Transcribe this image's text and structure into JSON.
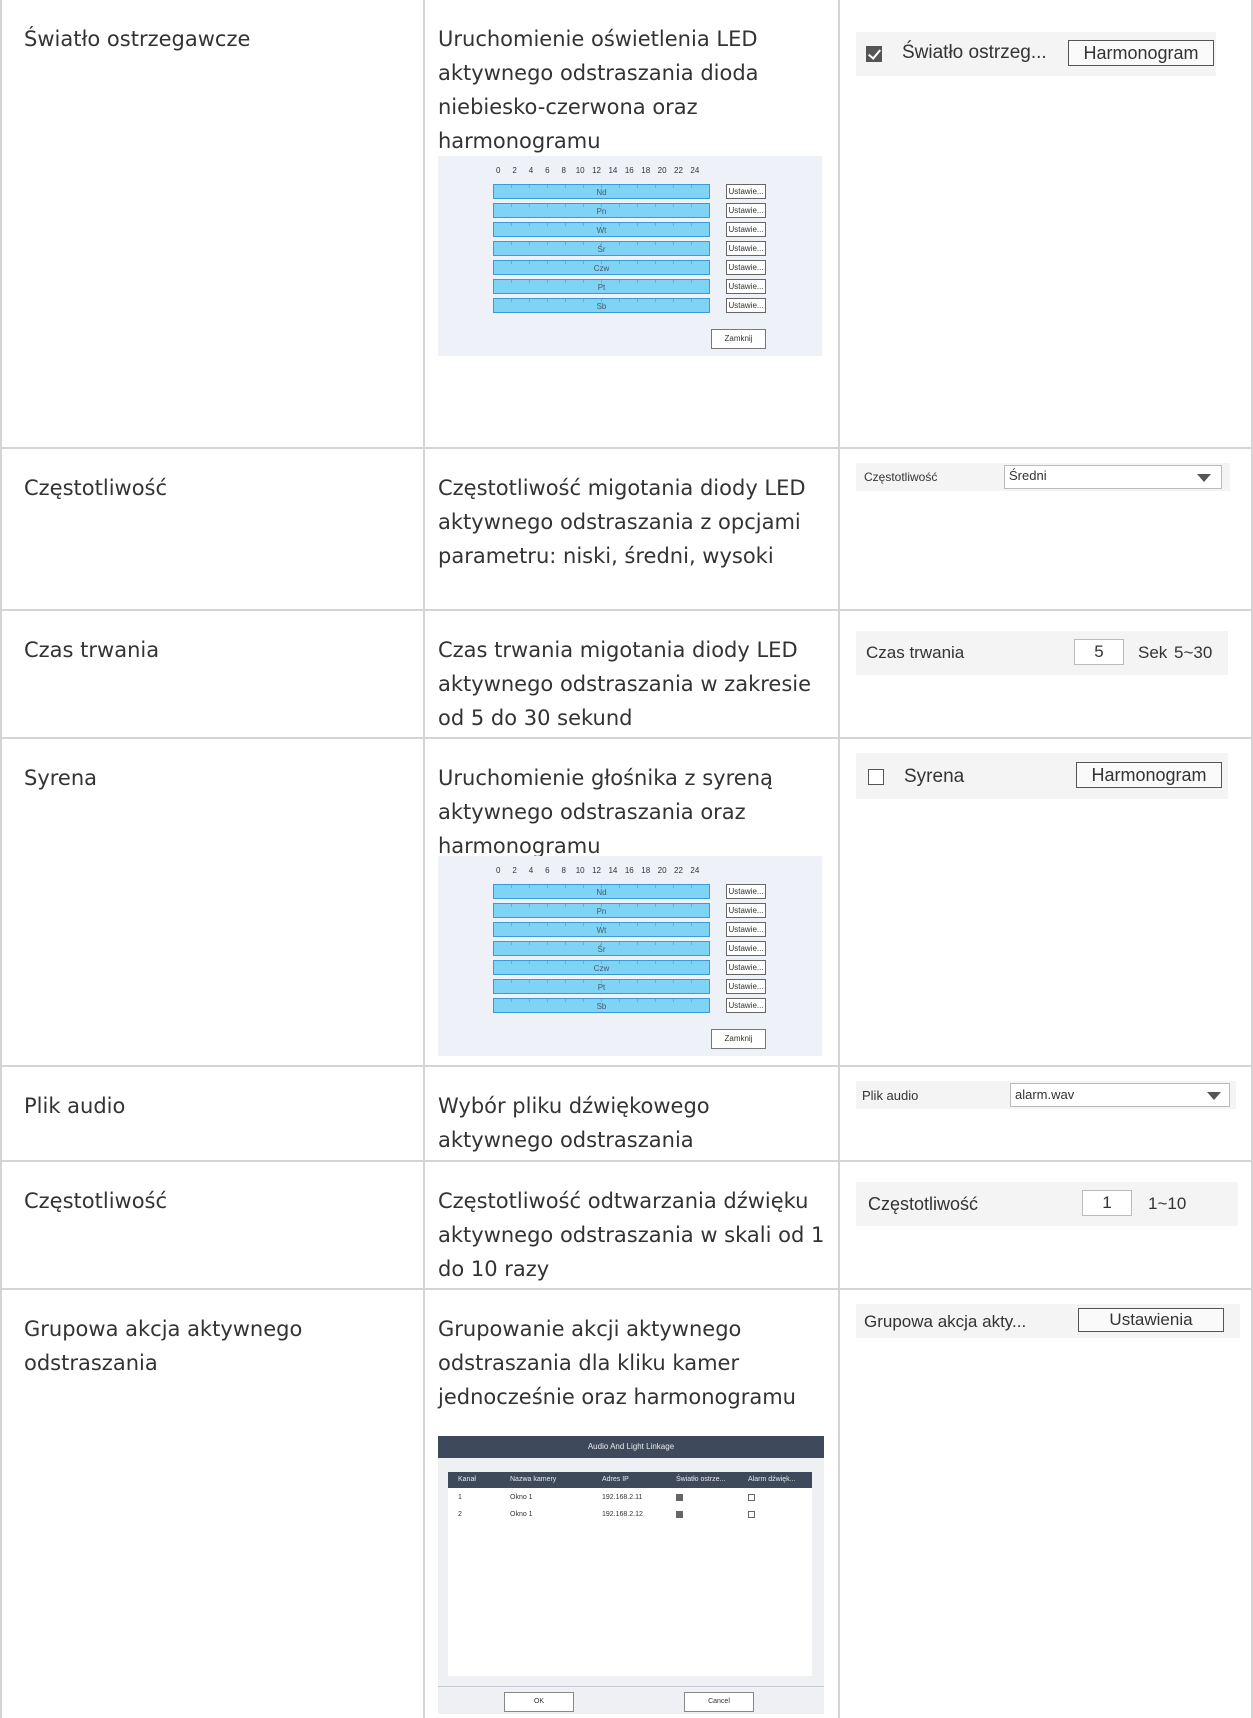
{
  "rows": [
    {
      "name": "Światło ostrzegawcze",
      "description": "Uruchomienie oświetlenia LED aktywnego odstraszania dioda niebiesko-czerwona oraz harmonogramu",
      "ui": {
        "checkbox_checked": true,
        "label": "Światło ostrzeg...",
        "button": "Harmonogram"
      }
    },
    {
      "name": "Częstotliwość",
      "description": "Częstotliwość migotania diody LED aktywnego odstraszania z opcjami parametru: niski, średni, wysoki",
      "ui": {
        "label": "Częstotliwość",
        "value": "Średni"
      }
    },
    {
      "name": "Czas trwania",
      "description": "Czas trwania migotania diody LED aktywnego odstraszania w zakresie od 5 do 30 sekund",
      "ui": {
        "label": "Czas trwania",
        "value": "5",
        "unit": "Sek",
        "range": "5~30"
      }
    },
    {
      "name": "Syrena",
      "description": "Uruchomienie głośnika z syreną aktywnego odstraszania oraz harmonogramu",
      "ui": {
        "checkbox_checked": false,
        "label": "Syrena",
        "button": "Harmonogram"
      }
    },
    {
      "name": "Plik audio",
      "description": "Wybór pliku dźwiękowego aktywnego odstraszania",
      "ui": {
        "label": "Plik audio",
        "value": "alarm.wav"
      }
    },
    {
      "name": "Częstotliwość",
      "description": "Częstotliwość odtwarzania dźwięku aktywnego odstraszania w skali od 1 do 10 razy",
      "ui": {
        "label": "Częstotliwość",
        "value": "1",
        "range": "1~10"
      }
    },
    {
      "name": "Grupowa akcja aktywnego odstraszania",
      "description": "Grupowanie akcji aktywnego odstraszania dla kliku kamer jednocześnie oraz harmonogramu",
      "ui": {
        "label": "Grupowa akcja akty...",
        "button": "Ustawienia"
      }
    }
  ],
  "schedule": {
    "hours": [
      "0",
      "2",
      "4",
      "6",
      "8",
      "10",
      "12",
      "14",
      "16",
      "18",
      "20",
      "22",
      "24"
    ],
    "days": [
      "Nd",
      "Pn",
      "Wt",
      "Śr",
      "Czw",
      "Pt",
      "Sb"
    ],
    "set_button": "Ustawie...",
    "close_button": "Zamknij"
  },
  "linkage": {
    "title": "Audio And Light Linkage",
    "columns": [
      "Kanał",
      "Nazwa kamery",
      "Adres IP",
      "Światło ostrze...",
      "Alarm dźwięk..."
    ],
    "rows": [
      {
        "channel": "1",
        "camera": "Okno 1",
        "ip": "192.168.2.11",
        "light": true,
        "sound": false
      },
      {
        "channel": "2",
        "camera": "Okno 1",
        "ip": "192.168.2.12",
        "light": true,
        "sound": false
      }
    ],
    "ok": "OK",
    "cancel": "Cancel"
  },
  "colors": {
    "bar": "#7fd3f5",
    "grid": "#d4d4d4",
    "panel": "#eef1f7",
    "dialog_header": "#3e4a5b"
  }
}
